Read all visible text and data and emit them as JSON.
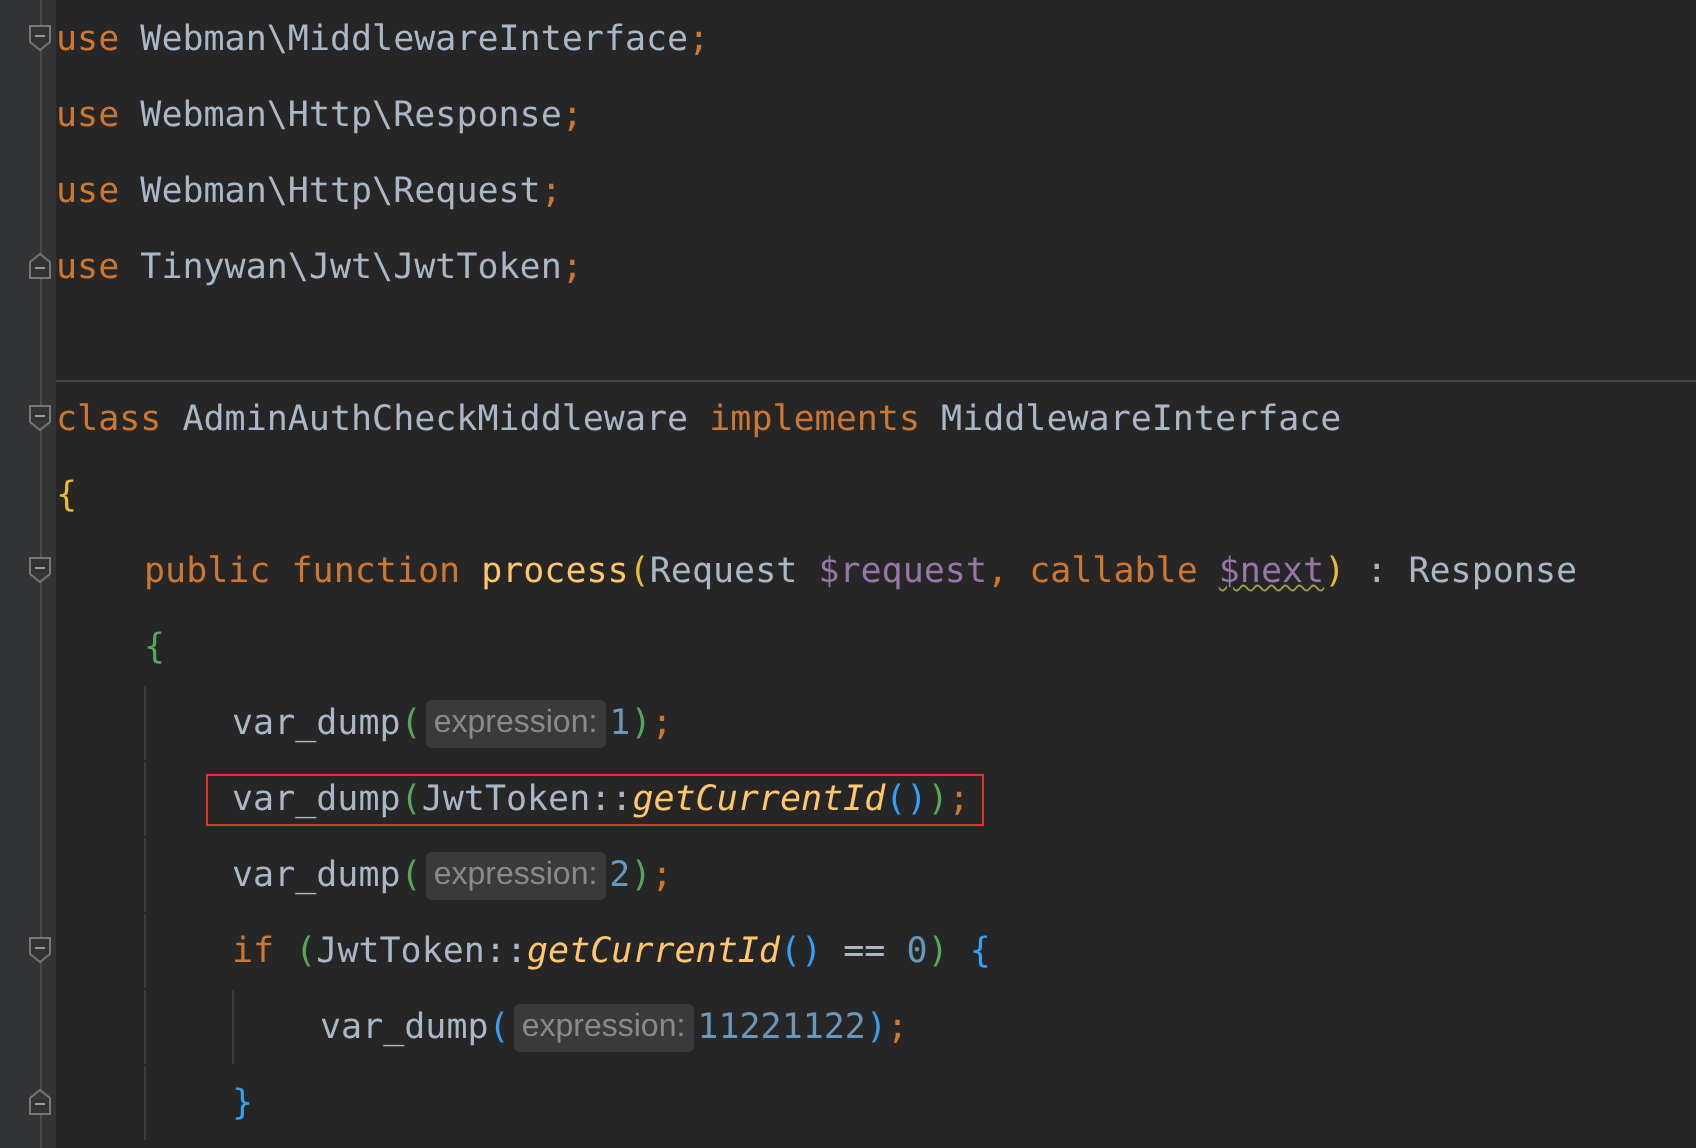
{
  "editor": {
    "lines": [
      {
        "fold": {
          "kind": "start"
        },
        "tokens": [
          {
            "t": "use ",
            "kind": "kw"
          },
          {
            "t": "Webman\\MiddlewareInterface",
            "kind": "cls"
          },
          {
            "t": ";",
            "kind": "punct"
          }
        ]
      },
      {
        "tokens": [
          {
            "t": "use ",
            "kind": "kw"
          },
          {
            "t": "Webman\\Http\\Response",
            "kind": "cls"
          },
          {
            "t": ";",
            "kind": "punct"
          }
        ]
      },
      {
        "tokens": [
          {
            "t": "use ",
            "kind": "kw"
          },
          {
            "t": "Webman\\Http\\Request",
            "kind": "cls"
          },
          {
            "t": ";",
            "kind": "punct"
          }
        ]
      },
      {
        "fold": {
          "kind": "end"
        },
        "tokens": [
          {
            "t": "use ",
            "kind": "kw"
          },
          {
            "t": "Tinywan\\Jwt\\JwtToken",
            "kind": "cls"
          },
          {
            "t": ";",
            "kind": "punct"
          }
        ]
      },
      {
        "fold": {
          "kind": "start"
        },
        "separator": true,
        "tokens": [
          {
            "t": "class ",
            "kind": "kw"
          },
          {
            "t": "AdminAuthCheckMiddleware ",
            "kind": "cls"
          },
          {
            "t": "implements ",
            "kind": "kw"
          },
          {
            "t": "MiddlewareInterface",
            "kind": "cls"
          }
        ]
      },
      {
        "tokens": [
          {
            "t": "{",
            "kind": "yellow"
          }
        ],
        "children": [
          {
            "fold": {
              "kind": "start"
            },
            "tokens": [
              {
                "t": "public function ",
                "kind": "kw"
              },
              {
                "t": "process",
                "kind": "fn"
              },
              {
                "t": "(",
                "kind": "yellow"
              },
              {
                "t": "Request ",
                "kind": "cls"
              },
              {
                "t": "$request",
                "kind": "var"
              },
              {
                "t": ", ",
                "kind": "punct"
              },
              {
                "t": "callable ",
                "kind": "kw"
              },
              {
                "t": "$next",
                "kind": "var-warn"
              },
              {
                "t": ")",
                "kind": "yellow"
              },
              {
                "t": " : Response",
                "kind": "cls"
              }
            ]
          },
          {
            "tokens": [
              {
                "t": "{",
                "kind": "green"
              }
            ],
            "children": [
              {
                "tokens": [
                  {
                    "t": "var_dump",
                    "kind": "cls"
                  },
                  {
                    "t": "(",
                    "kind": "green"
                  },
                  {
                    "t": "expression:",
                    "kind": "hint"
                  },
                  {
                    "t": "1",
                    "kind": "num"
                  },
                  {
                    "t": ")",
                    "kind": "green"
                  },
                  {
                    "t": ";",
                    "kind": "punct"
                  }
                ]
              },
              {
                "highlighted": true,
                "tokens": [
                  {
                    "t": "var_dump",
                    "kind": "cls"
                  },
                  {
                    "t": "(",
                    "kind": "green"
                  },
                  {
                    "t": "JwtToken::",
                    "kind": "cls"
                  },
                  {
                    "t": "getCurrentId",
                    "kind": "static"
                  },
                  {
                    "t": "()",
                    "kind": "blue"
                  },
                  {
                    "t": ")",
                    "kind": "green"
                  },
                  {
                    "t": ";",
                    "kind": "punct"
                  }
                ]
              },
              {
                "tokens": [
                  {
                    "t": "var_dump",
                    "kind": "cls"
                  },
                  {
                    "t": "(",
                    "kind": "green"
                  },
                  {
                    "t": "expression:",
                    "kind": "hint"
                  },
                  {
                    "t": "2",
                    "kind": "num"
                  },
                  {
                    "t": ")",
                    "kind": "green"
                  },
                  {
                    "t": ";",
                    "kind": "punct"
                  }
                ]
              },
              {
                "fold": {
                  "kind": "start"
                },
                "tokens": [
                  {
                    "t": "if ",
                    "kind": "kw"
                  },
                  {
                    "t": "(",
                    "kind": "green"
                  },
                  {
                    "t": "JwtToken::",
                    "kind": "cls"
                  },
                  {
                    "t": "getCurrentId",
                    "kind": "static"
                  },
                  {
                    "t": "()",
                    "kind": "blue"
                  },
                  {
                    "t": " == ",
                    "kind": "cls"
                  },
                  {
                    "t": "0",
                    "kind": "num"
                  },
                  {
                    "t": ")",
                    "kind": "green"
                  },
                  {
                    "t": " {",
                    "kind": "blue"
                  }
                ],
                "children": [
                  {
                    "tokens": [
                      {
                        "t": "var_dump",
                        "kind": "cls"
                      },
                      {
                        "t": "(",
                        "kind": "blue"
                      },
                      {
                        "t": "expression:",
                        "kind": "hint"
                      },
                      {
                        "t": "11221122",
                        "kind": "num"
                      },
                      {
                        "t": ")",
                        "kind": "blue"
                      },
                      {
                        "t": ";",
                        "kind": "punct"
                      }
                    ]
                  }
                ]
              },
              {
                "fold": {
                  "kind": "end"
                },
                "tokens": [
                  {
                    "t": "}",
                    "kind": "blue"
                  }
                ]
              }
            ]
          }
        ]
      }
    ]
  }
}
